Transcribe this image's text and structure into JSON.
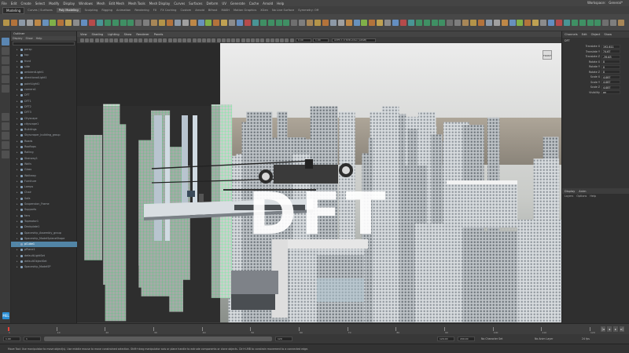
{
  "app": {
    "menus": [
      "File",
      "Edit",
      "Create",
      "Select",
      "Modify",
      "Display",
      "Windows",
      "Mesh",
      "Edit Mesh",
      "Mesh Tools",
      "Mesh Display",
      "Curves",
      "Surfaces",
      "Deform",
      "UV",
      "Generate",
      "Cache",
      "Arnold",
      "Help"
    ],
    "workspace_label": "Workspace:",
    "workspace_value": "General*",
    "menuset": "Modeling",
    "live_surface": "No Live Surface",
    "symmetry": "Symmetry: Off"
  },
  "shelf_tabs": [
    "Curves / Surfaces",
    "Poly Modeling",
    "Sculpting",
    "Rigging",
    "Animation",
    "Rendering",
    "FX",
    "FX Caching",
    "Custom",
    "Arnold",
    "Bifrost",
    "MASH",
    "Motion Graphics",
    "XGen"
  ],
  "shelf_active": "Poly Modeling",
  "outliner": {
    "title": "Outliner",
    "menu": [
      "Display",
      "Show",
      "Help"
    ],
    "items": [
      {
        "label": "persp",
        "sel": false
      },
      {
        "label": "top",
        "sel": false
      },
      {
        "label": "front",
        "sel": false
      },
      {
        "label": "side",
        "sel": false
      },
      {
        "label": "ambientLight1",
        "sel": false
      },
      {
        "label": "directionalLight1",
        "sel": false
      },
      {
        "label": "pointLight1",
        "sel": false
      },
      {
        "label": "camera1",
        "sel": false
      },
      {
        "label": "DFT",
        "sel": false
      },
      {
        "label": "DFT1",
        "sel": false
      },
      {
        "label": "DFT2",
        "sel": false
      },
      {
        "label": "DFT3",
        "sel": false
      },
      {
        "label": "Cityscape",
        "sel": false
      },
      {
        "label": "cityscape1",
        "sel": false
      },
      {
        "label": "Buildings",
        "sel": false
      },
      {
        "label": "Skyscraper_building_group",
        "sel": false
      },
      {
        "label": "Roads",
        "sel": false
      },
      {
        "label": "Rooftops",
        "sel": false
      },
      {
        "label": "Railing",
        "sel": false
      },
      {
        "label": "Stairway1",
        "sel": false
      },
      {
        "label": "Walls",
        "sel": false
      },
      {
        "label": "Glass",
        "sel": false
      },
      {
        "label": "Walkway",
        "sel": false
      },
      {
        "label": "Furniture",
        "sel": false
      },
      {
        "label": "Lamps",
        "sel": false
      },
      {
        "label": "Chair",
        "sel": false
      },
      {
        "label": "Sofa",
        "sel": false
      },
      {
        "label": "Suspension_Frame",
        "sel": false
      },
      {
        "label": "Supports",
        "sel": false
      },
      {
        "label": "fans",
        "sel": false
      },
      {
        "label": "Topmotor1",
        "sel": false
      },
      {
        "label": "Deckplate1",
        "sel": false
      },
      {
        "label": "Spaceship_Assembly_group",
        "sel": false
      },
      {
        "label": "Spaceship_ModelSplaneShape",
        "sel": false
      },
      {
        "label": "pCube1",
        "sel": true
      },
      {
        "label": "pPlane1",
        "sel": false
      },
      {
        "label": "defaultLightSet",
        "sel": false
      },
      {
        "label": "defaultObjectSet",
        "sel": false
      },
      {
        "label": "Spaceship_ModelSP",
        "sel": false
      }
    ]
  },
  "viewport": {
    "panel_menus": [
      "View",
      "Shading",
      "Lighting",
      "Show",
      "Renderer",
      "Panels"
    ],
    "camera_field": "0.00",
    "camera_field2": "1.00",
    "resolution": "ACES 1.0 SDR-video (sRGB)",
    "viewcube_label": "FRONT",
    "watermark": "DFT"
  },
  "channel_box": {
    "tabs": [
      "Channels",
      "Edit",
      "Object",
      "Show"
    ],
    "object": "DFT",
    "channels": [
      {
        "name": "Translate X",
        "value": "192.611"
      },
      {
        "name": "Translate Y",
        "value": "74.67"
      },
      {
        "name": "Translate Z",
        "value": "-39.63"
      },
      {
        "name": "Rotate X",
        "value": "0"
      },
      {
        "name": "Rotate Y",
        "value": "0"
      },
      {
        "name": "Rotate Z",
        "value": "0"
      },
      {
        "name": "Scale X",
        "value": "4.087"
      },
      {
        "name": "Scale Y",
        "value": "4.087"
      },
      {
        "name": "Scale Z",
        "value": "4.087"
      },
      {
        "name": "Visibility",
        "value": "on"
      }
    ]
  },
  "layer_editor": {
    "tabs": [
      "Display",
      "Anim"
    ],
    "menus": [
      "Layers",
      "Options",
      "Help"
    ]
  },
  "time_slider": {
    "ticks": [
      "1",
      "10",
      "20",
      "30",
      "40",
      "50",
      "60",
      "70",
      "80",
      "90",
      "100",
      "110",
      "120"
    ],
    "current_frame": "1"
  },
  "range_slider": {
    "start": "1.00",
    "inner_start": "1",
    "inner_end": "120",
    "end": "120.00",
    "end2": "200.00",
    "character_set": "No Character Set",
    "anim_layer": "No Anim Layer",
    "fps": "24 fps"
  },
  "help_line": "Move Tool: Use manipulator to move object(s). Use middle mouse to move constrained selection. Shift+drag manipulator axis or plane handle to extrude components or clone objects. Ctrl+LMB to constrain movement to a connected edge.",
  "mel": "MEL",
  "colors": {
    "wire_green": "#4cff88",
    "selection_blue": "#5285a6",
    "ui_bg": "#3c3c3c"
  }
}
